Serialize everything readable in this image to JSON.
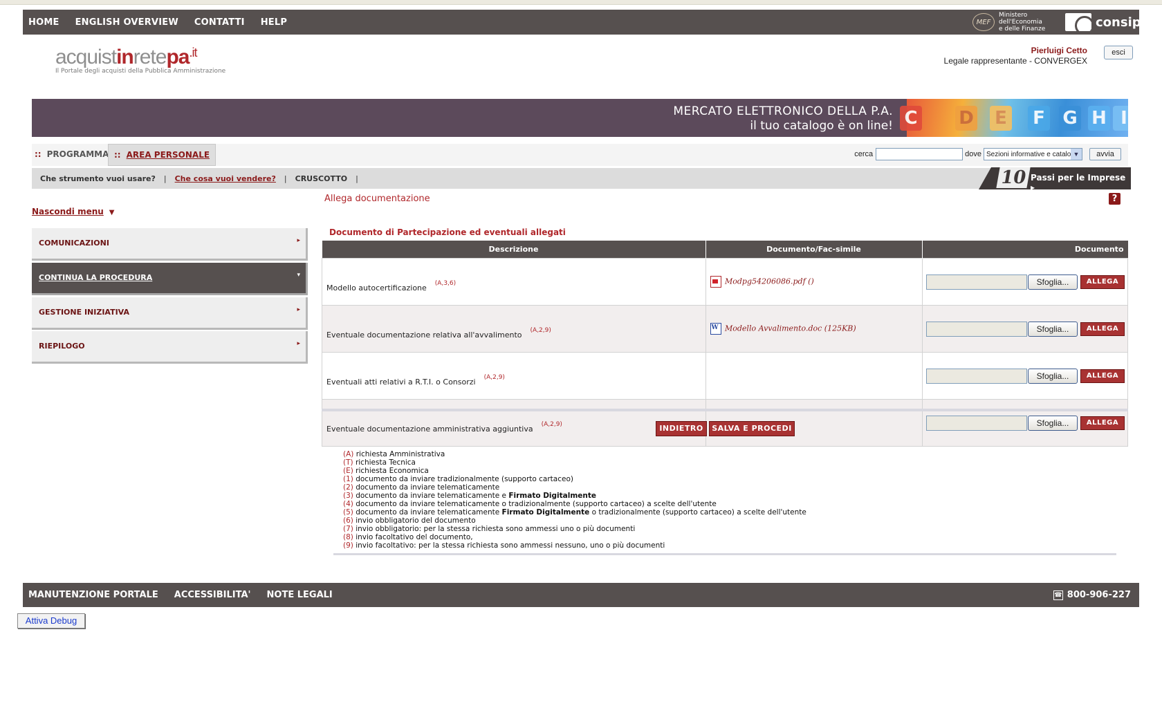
{
  "topnav": [
    "HOME",
    "ENGLISH OVERVIEW",
    "CONTATTI",
    "HELP"
  ],
  "mef": {
    "logo": "MEF",
    "line1": "Ministero",
    "line2": "dell'Economia",
    "line3": "e delle Finanze"
  },
  "consip": "consip",
  "brand": {
    "part1": "acquist",
    "part2": "in",
    "part3": "rete",
    "part4": "pa",
    "part5": ".it",
    "subtitle": "Il Portale degli acquisti della Pubblica Amministrazione"
  },
  "user": {
    "name": "Pierluigi Cetto",
    "role": "Legale rappresentante - CONVERGEX",
    "logout": "esci"
  },
  "banner": {
    "line1": "MERCATO ELETTRONICO DELLA P.A.",
    "line2": "il tuo catalogo è on line!",
    "tiles": [
      "C",
      "D",
      "E",
      "F",
      "G",
      "H",
      "I"
    ]
  },
  "tabs": {
    "programma": "PROGRAMMA",
    "area": "AREA PERSONALE",
    "dots": "::"
  },
  "search": {
    "label": "cerca",
    "where": "dove",
    "select": "Sezioni informative e catalogo",
    "button": "avvia"
  },
  "subnav": {
    "q1": "Che strumento vuoi usare?",
    "q2": "Che cosa vuoi vendere?",
    "q3": "CRUSCOTTO",
    "sep": "|"
  },
  "passi": {
    "num": "10",
    "text": "Passi per le Imprese"
  },
  "hide_menu": "Nascondi menu",
  "menu": [
    {
      "label": "COMUNICAZIONI",
      "arrow": "▸"
    },
    {
      "label": "CONTINUA LA PROCEDURA",
      "arrow": "▾"
    },
    {
      "label": "GESTIONE INIZIATIVA",
      "arrow": "▸"
    },
    {
      "label": "RIEPILOGO",
      "arrow": "▸"
    }
  ],
  "page_title": "Allega documentazione",
  "help_icon": "?",
  "section_title": "Documento di Partecipazione ed eventuali allegati",
  "table": {
    "headers": [
      "Descrizione",
      "Documento/Fac-simile",
      "Documento"
    ],
    "rows": [
      {
        "desc": "Modello autocertificazione",
        "codes": "(A,3,6)",
        "file": "Modpg54206086.pdf ()"
      },
      {
        "desc": "Eventuale documentazione relativa all'avvalimento",
        "codes": "(A,2,9)",
        "file": "Modello Avvalimento.doc (125KB)"
      },
      {
        "desc": "Eventuali atti relativi a R.T.I. o Consorzi",
        "codes": "(A,2,9)",
        "file": ""
      },
      {
        "desc": "Eventuale documentazione amministrativa aggiuntiva",
        "codes": "(A,2,9)",
        "file": ""
      }
    ],
    "browse": "Sfoglia...",
    "attach": "ALLEGA"
  },
  "actions": {
    "back": "INDIETRO",
    "save": "SALVA E PROCEDI"
  },
  "legend": [
    {
      "k": "(A)",
      "t": "richiesta Amministrativa"
    },
    {
      "k": "(T)",
      "t": "richiesta Tecnica"
    },
    {
      "k": "(E)",
      "t": "richiesta Economica"
    },
    {
      "k": "(1)",
      "t": "documento da inviare tradizionalmente (supporto cartaceo)"
    },
    {
      "k": "(2)",
      "t": "documento da inviare telematicamente"
    },
    {
      "k": "(3)",
      "t": "documento da inviare telematicamente e",
      "b": "Firmato Digitalmente"
    },
    {
      "k": "(4)",
      "t": "documento da inviare telematicamente o tradizionalmente (supporto cartaceo) a scelte dell'utente"
    },
    {
      "k": "(5)",
      "t": "documento da inviare telematicamente",
      "b": "Firmato Digitalmente",
      "t2": "o tradizionalmente (supporto cartaceo) a scelte dell'utente"
    },
    {
      "k": "(6)",
      "t": "invio obbligatorio del documento"
    },
    {
      "k": "(7)",
      "t": "invio obbligatorio: per la stessa richiesta sono ammessi uno o più documenti"
    },
    {
      "k": "(8)",
      "t": "invio facoltativo del documento,"
    },
    {
      "k": "(9)",
      "t": "invio facoltativo: per la stessa richiesta sono ammessi nessuno, uno o più documenti"
    }
  ],
  "footer": {
    "items": [
      "MANUTENZIONE PORTALE",
      "ACCESSIBILITA'",
      "NOTE LEGALI"
    ],
    "phone": "800-906-227"
  },
  "debug": "Attiva Debug",
  "colors": {
    "bar": "#56504f",
    "accent": "#b0272b",
    "banner": "#5c4a5b"
  }
}
